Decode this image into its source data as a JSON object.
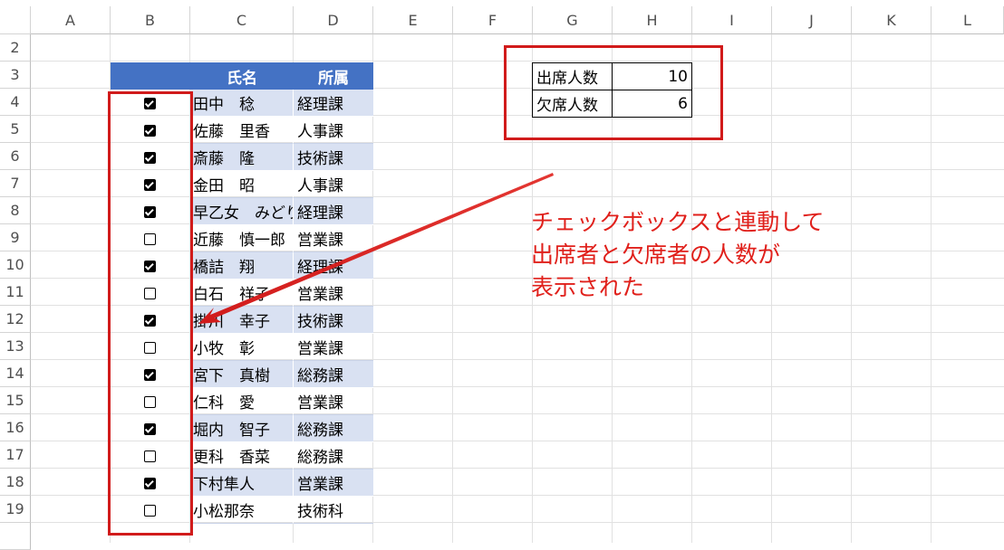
{
  "columns": [
    "A",
    "B",
    "C",
    "D",
    "E",
    "F",
    "G",
    "H",
    "I",
    "J",
    "K",
    "L"
  ],
  "rows": [
    "2",
    "3",
    "4",
    "5",
    "6",
    "7",
    "8",
    "9",
    "10",
    "11",
    "12",
    "13",
    "14",
    "15",
    "16",
    "17",
    "18",
    "19"
  ],
  "table": {
    "header_name": "氏名",
    "header_dept": "所属",
    "records": [
      {
        "checked": true,
        "name": "田中　稔",
        "dept": "経理課"
      },
      {
        "checked": true,
        "name": "佐藤　里香",
        "dept": "人事課"
      },
      {
        "checked": true,
        "name": "斎藤　隆",
        "dept": "技術課"
      },
      {
        "checked": true,
        "name": "金田　昭",
        "dept": "人事課"
      },
      {
        "checked": true,
        "name": "早乙女　みどり",
        "dept": "経理課"
      },
      {
        "checked": false,
        "name": "近藤　慎一郎",
        "dept": "営業課"
      },
      {
        "checked": true,
        "name": "橋詰　翔",
        "dept": "経理課"
      },
      {
        "checked": false,
        "name": "白石　祥子",
        "dept": "営業課"
      },
      {
        "checked": true,
        "name": "掛川　幸子",
        "dept": "技術課"
      },
      {
        "checked": false,
        "name": "小牧　彰",
        "dept": "営業課"
      },
      {
        "checked": true,
        "name": "宮下　真樹",
        "dept": "総務課"
      },
      {
        "checked": false,
        "name": "仁科　愛",
        "dept": "営業課"
      },
      {
        "checked": true,
        "name": "堀内　智子",
        "dept": "総務課"
      },
      {
        "checked": false,
        "name": "更科　香菜",
        "dept": "総務課"
      },
      {
        "checked": true,
        "name": "下村隼人",
        "dept": "営業課"
      },
      {
        "checked": false,
        "name": "小松那奈",
        "dept": "技術科"
      }
    ]
  },
  "summary": {
    "present_label": "出席人数",
    "present_value": "10",
    "absent_label": "欠席人数",
    "absent_value": "6"
  },
  "annotation": {
    "lines": [
      "チェックボックスと連動して",
      "出席者と欠席者の人数が",
      "表示された"
    ]
  },
  "colors": {
    "header_fill": "#4472c4",
    "band_fill": "#d9e1f2",
    "highlight": "#d11b1b",
    "annotation_text": "#e0201b"
  }
}
